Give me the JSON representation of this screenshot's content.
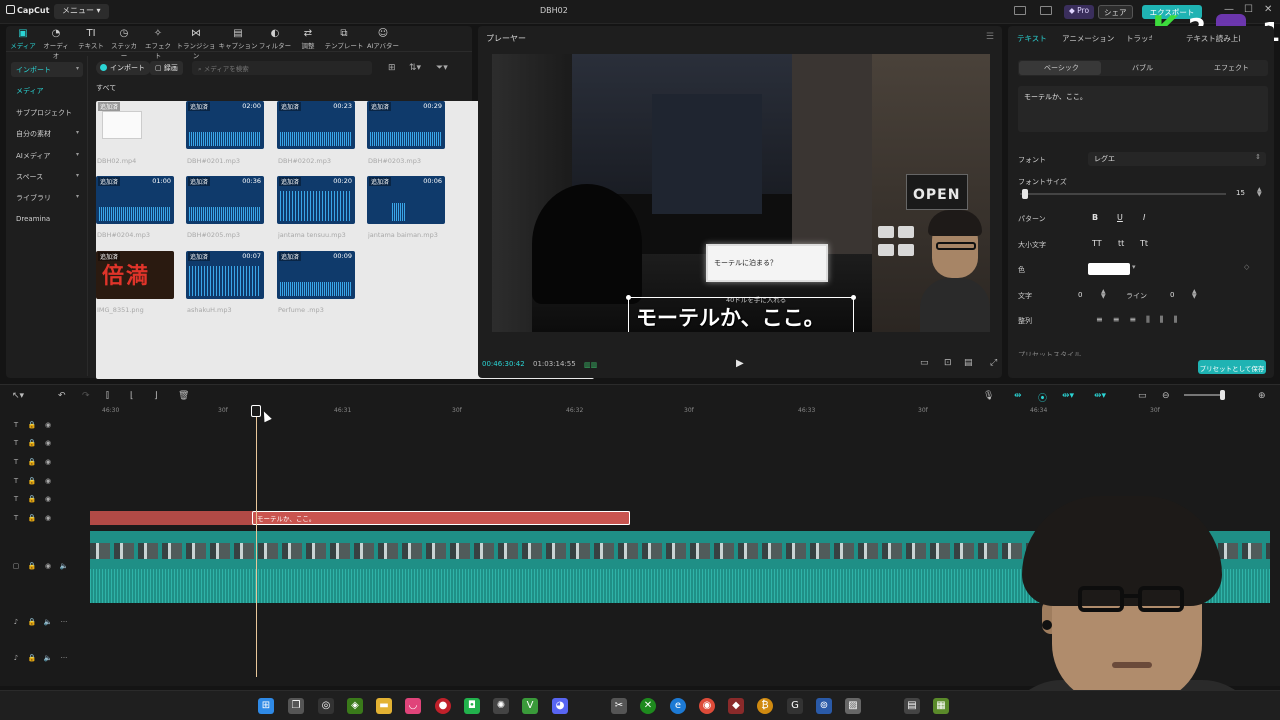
{
  "window": {
    "app_name": "CapCut",
    "menu_label": "メニュー",
    "title": "DBH02",
    "pro_label": "Pro",
    "share_label": "シェア",
    "export_label": "エクスポート"
  },
  "media_toolbar": {
    "tools": [
      {
        "label": "メディア",
        "icon": "media-icon",
        "glyph": "▣"
      },
      {
        "label": "オーディオ",
        "icon": "audio-icon",
        "glyph": "◔"
      },
      {
        "label": "テキスト",
        "icon": "text-icon",
        "glyph": "TI"
      },
      {
        "label": "ステッカー",
        "icon": "sticker-icon",
        "glyph": "◷"
      },
      {
        "label": "エフェクト",
        "icon": "effect-icon",
        "glyph": "✧"
      },
      {
        "label": "トランジション",
        "icon": "transition-icon",
        "glyph": "⋈"
      },
      {
        "label": "キャプション",
        "icon": "caption-icon",
        "glyph": "▤"
      },
      {
        "label": "フィルター",
        "icon": "filter-icon",
        "glyph": "◐"
      },
      {
        "label": "調整",
        "icon": "adjust-icon",
        "glyph": "⇄"
      },
      {
        "label": "テンプレート",
        "icon": "template-icon",
        "glyph": "⧉"
      },
      {
        "label": "AIアバター",
        "icon": "avatar-icon",
        "glyph": "☺"
      }
    ]
  },
  "media_sidebar": {
    "items": [
      {
        "label": "インポート"
      },
      {
        "label": "メディア"
      },
      {
        "label": "サブプロジェクト"
      },
      {
        "label": "自分の素材"
      },
      {
        "label": "AIメディア"
      },
      {
        "label": "スペース"
      },
      {
        "label": "ライブラリ"
      },
      {
        "label": "Dreamina"
      }
    ]
  },
  "media_bar": {
    "import_label": "インポート",
    "record_label": "録画",
    "search_placeholder": "メディアを検索",
    "all_label": "すべて"
  },
  "media_items": [
    {
      "name": "DBH02.mp4",
      "badge": "追加済",
      "duration": "",
      "kind": "video"
    },
    {
      "name": "DBH#0201.mp3",
      "badge": "追加済",
      "duration": "02:00",
      "kind": "audio"
    },
    {
      "name": "DBH#0202.mp3",
      "badge": "追加済",
      "duration": "00:23",
      "kind": "audio"
    },
    {
      "name": "DBH#0203.mp3",
      "badge": "追加済",
      "duration": "00:29",
      "kind": "audio"
    },
    {
      "name": "DBH#0204.mp3",
      "badge": "追加済",
      "duration": "01:00",
      "kind": "audio"
    },
    {
      "name": "DBH#0205.mp3",
      "badge": "追加済",
      "duration": "00:36",
      "kind": "audio"
    },
    {
      "name": "jantama tensuu.mp3",
      "badge": "追加済",
      "duration": "00:20",
      "kind": "audio-tall"
    },
    {
      "name": "jantama baiman.mp3",
      "badge": "追加済",
      "duration": "00:06",
      "kind": "audio-small"
    },
    {
      "name": "IMG_8351.png",
      "badge": "追加済",
      "duration": "",
      "kind": "image",
      "image_text": "倍満"
    },
    {
      "name": "ashakuH.mp3",
      "badge": "追加済",
      "duration": "00:07",
      "kind": "audio-tall"
    },
    {
      "name": "Perfume .mp3",
      "badge": "追加済",
      "duration": "00:09",
      "kind": "audio"
    }
  ],
  "player": {
    "title": "プレーヤー",
    "current_time": "00:46:30:42",
    "total_time": "01:03:14:55",
    "caption_text": "モーテルか、ここ。",
    "game_dialog": "モーテルに泊まる？",
    "game_sub": "40ドルを手に入れる",
    "sign_text": "OPEN"
  },
  "properties": {
    "tabs": [
      "テキスト",
      "アニメーション",
      "トラッキング",
      "テキスト読み上げ"
    ],
    "subtabs": [
      "ベーシック",
      "バブル",
      "エフェクト"
    ],
    "text_value": "モーテルか、ここ。",
    "font_label": "フォント",
    "font_value": "レグエ",
    "font_size_label": "フォントサイズ",
    "font_size_value": "15",
    "font_size_level": 0.05,
    "pattern_label": "パターン",
    "pattern_buttons": [
      "B",
      "U",
      "I"
    ],
    "case_label": "大小文字",
    "case_buttons": [
      "TT",
      "tt",
      "Tt"
    ],
    "color_label": "色",
    "color_value": "#ffffff",
    "char_label": "文字",
    "char_value": "0",
    "line_label": "ライン",
    "line_value": "0",
    "align_label": "整列",
    "preset_style_label": "プリセットスタイル",
    "save_preset_label": "プリセットとして保存"
  },
  "timeline": {
    "ruler_labels": [
      "46:30",
      "30f",
      "46:31",
      "30f",
      "46:32",
      "30f",
      "46:33",
      "30f",
      "46:34",
      "30f"
    ],
    "text_clip_label": "モーテルか、ここ。",
    "accent": "#2bd5d5",
    "text_track_color": "#c9544f",
    "video_track_color": "#1f8f86"
  },
  "overlay": {
    "k": "K",
    "two": "2",
    "one": "1"
  },
  "taskbar": {
    "icons": [
      "windows-start-icon",
      "task-view-icon",
      "media-player-icon",
      "nvidia-icon",
      "file-explorer-icon",
      "lips-icon",
      "record-icon",
      "line-icon",
      "chatgpt-icon",
      "vim-icon",
      "discord-icon",
      "capcut-icon",
      "xbox-icon",
      "edge-icon",
      "chrome-icon",
      "game-icon",
      "bitcoin-icon",
      "g-icon",
      "app-icon",
      "photos-icon",
      "notepad-icon",
      "minecraft-icon"
    ]
  }
}
